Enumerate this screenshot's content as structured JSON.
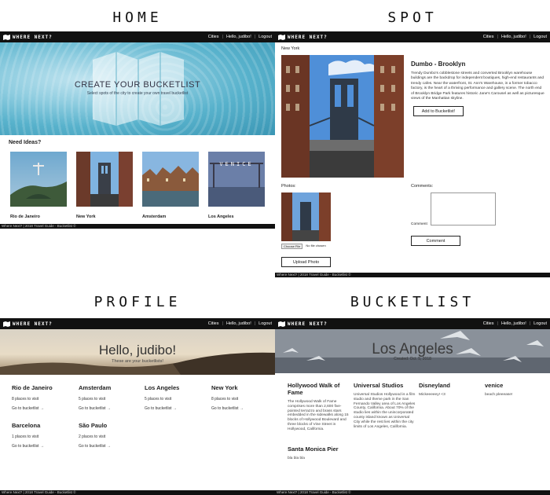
{
  "sections": {
    "home": "HOME",
    "spot": "SPOT",
    "profile": "PROFILE",
    "bucketlist": "BUCKETLIST"
  },
  "nav": {
    "brand": "WHERE NEXT?",
    "cities": "Cities",
    "hello": "Hello, judibo!",
    "logout": "Logout",
    "sep": "|"
  },
  "footer": "Where Next? | 2018 Travel Guide - Bucketlist ©",
  "home": {
    "hero_title": "CREATE YOUR BUCKETLIST",
    "hero_subtitle": "Select spots of the city to create your own travel bucketlist",
    "ideas_heading": "Need Ideas?",
    "ideas": [
      {
        "name": "Rio de Janeiro",
        "more": "See more →"
      },
      {
        "name": "New York",
        "more": "See more →"
      },
      {
        "name": "Amsterdam",
        "more": "See more →"
      },
      {
        "name": "Los Angeles",
        "more": "See more →"
      }
    ],
    "la_sign": "VENICE"
  },
  "spot": {
    "breadcrumb": "New York",
    "title": "Dumbo - Brooklyn",
    "description": "Trendy Dumbo's cobblestone streets and converted Brooklyn warehouse buildings are the backdrop for independent boutiques, high-end restaurants and trendy cafes. Near the waterfront, St. Ann's Warehouse, in a former tobacco factory, is the heart of a thriving performance and gallery scene. The north end of Brooklyn Bridge Park features historic Jane's Carousel as well as picturesque views of the Manhattan skyline.",
    "add_button": "Add to Bucketlist!",
    "photos_label": "Photos:",
    "choose_file": "Choose File",
    "no_file": "No file chosen",
    "upload_button": "Upload Photo",
    "comments_label": "Comments:",
    "comment_label": "Comment",
    "comment_button": "Comment"
  },
  "profile": {
    "greeting": "Hello, judibo!",
    "subtitle": "These are your bucketlists!",
    "cities": [
      {
        "name": "Rio de Janeiro",
        "places": "8 places to visit",
        "go": "Go to bucketlist →"
      },
      {
        "name": "Amsterdam",
        "places": "5 places to visit",
        "go": "Go to bucketlist →"
      },
      {
        "name": "Los Angeles",
        "places": "5 places to visit",
        "go": "Go to bucketlist →"
      },
      {
        "name": "New York",
        "places": "8 places to visit",
        "go": "Go to bucketlist →"
      },
      {
        "name": "Barcelona",
        "places": "1 places to visit",
        "go": "Go to bucketlist →"
      },
      {
        "name": "São Paulo",
        "places": "2 places to visit",
        "go": "Go to bucketlist →"
      }
    ]
  },
  "bucketlist": {
    "city": "Los Angeles",
    "date": "Created: Oct. 5, 2018",
    "items": [
      {
        "name": "Hollywood Walk of Fame",
        "desc": "The Hollywood Walk of Fame comprises more than 2,600 five-pointed terrazzo and brass stars embedded in the sidewalks along 15 blocks of Hollywood Boulevard and three blocks of Vine Street in Hollywood, California."
      },
      {
        "name": "Universal Studios",
        "desc": "Universal Studios Hollywood is a film studio and theme park in the San Fernando Valley area of Los Angeles County, California. About 70% of the studio lies within the unincorporated county island known as Universal City while the rest lies within the city limits of Los Angeles, California."
      },
      {
        "name": "Disneyland",
        "desc": "Mickeeeeey! <3"
      },
      {
        "name": "venice",
        "desc": "beach pleeease!"
      },
      {
        "name": "Santa Monica Pier",
        "desc": "bla bla bla"
      }
    ]
  },
  "colors": {
    "nav_bg": "#111111",
    "water": "#58b2cc",
    "sky": "#5f9fd8"
  }
}
